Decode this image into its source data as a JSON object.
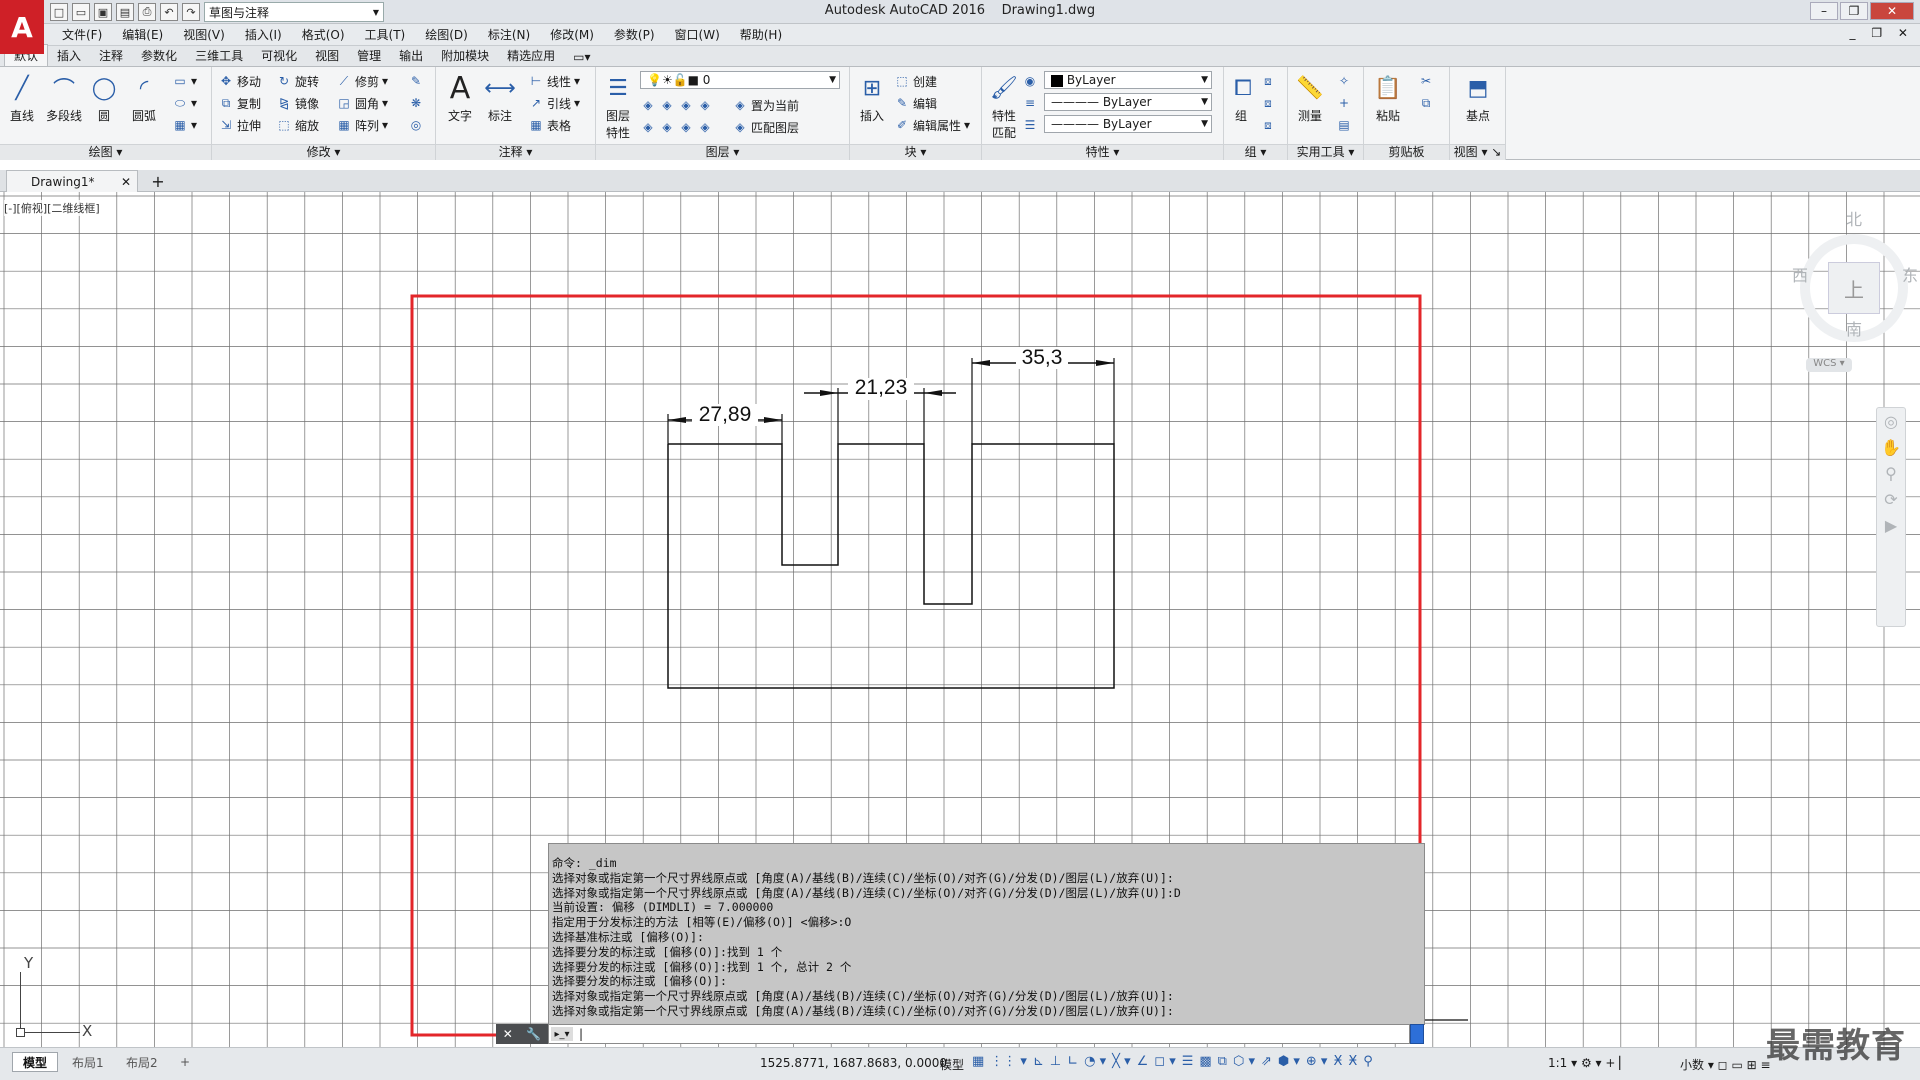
{
  "app": {
    "title": "Autodesk AutoCAD 2016",
    "document": "Drawing1.dwg",
    "logo": "A",
    "workspace": "草图与注释"
  },
  "menus": [
    "文件(F)",
    "编辑(E)",
    "视图(V)",
    "插入(I)",
    "格式(O)",
    "工具(T)",
    "绘图(D)",
    "标注(N)",
    "修改(M)",
    "参数(P)",
    "窗口(W)",
    "帮助(H)"
  ],
  "ribbon_tabs": [
    "默认",
    "插入",
    "注释",
    "参数化",
    "三维工具",
    "可视化",
    "视图",
    "管理",
    "输出",
    "附加模块",
    "精选应用"
  ],
  "ribbon": {
    "draw": {
      "title": "绘图",
      "line": "直线",
      "polyline": "多段线",
      "circle": "圆",
      "arc": "圆弧"
    },
    "modify": {
      "title": "修改",
      "move": "移动",
      "rotate": "旋转",
      "trim": "修剪",
      "copy": "复制",
      "mirror": "镜像",
      "fillet": "圆角",
      "stretch": "拉伸",
      "scale": "缩放",
      "array": "阵列"
    },
    "annotation": {
      "title": "注释",
      "text": "文字",
      "dimension": "标注",
      "linear": "线性",
      "leader": "引线",
      "table": "表格"
    },
    "layers": {
      "title": "图层",
      "properties": "图层\n特性",
      "layer_value": "0",
      "set_current": "置为当前",
      "match_layer": "匹配图层"
    },
    "block": {
      "title": "块",
      "insert": "插入",
      "create": "创建",
      "edit": "编辑",
      "edit_attr": "编辑属性"
    },
    "properties": {
      "title": "特性",
      "match": "特性\n匹配",
      "color": "ByLayer",
      "linetype": "ByLayer",
      "lineweight": "ByLayer"
    },
    "groups": {
      "title": "组",
      "group": "组"
    },
    "utilities": {
      "title": "实用工具",
      "measure": "测量"
    },
    "clipboard": {
      "title": "剪贴板",
      "paste": "粘贴"
    },
    "view": {
      "title": "视图",
      "base": "基点"
    }
  },
  "file_tab": {
    "name": "Drawing1*"
  },
  "viewport": {
    "label": "[-][俯视][二维线框]",
    "viewcube": {
      "north": "北",
      "south": "南",
      "east": "东",
      "west": "西",
      "top": "上",
      "wcs": "WCS"
    },
    "ucs": {
      "x": "X",
      "y": "Y"
    }
  },
  "dimensions": [
    "27,89",
    "21,23",
    "35,3"
  ],
  "command": {
    "lines": [
      "命令: _dim",
      "选择对象或指定第一个尺寸界线原点或 [角度(A)/基线(B)/连续(C)/坐标(O)/对齐(G)/分发(D)/图层(L)/放弃(U)]:",
      "选择对象或指定第一个尺寸界线原点或 [角度(A)/基线(B)/连续(C)/坐标(O)/对齐(G)/分发(D)/图层(L)/放弃(U)]:D",
      "当前设置: 偏移 (DIMDLI) = 7.000000",
      "指定用于分发标注的方法 [相等(E)/偏移(O)] <偏移>:O",
      "选择基准标注或 [偏移(O)]:",
      "选择要分发的标注或 [偏移(O)]:找到 1 个",
      "选择要分发的标注或 [偏移(O)]:找到 1 个, 总计 2 个",
      "选择要分发的标注或 [偏移(O)]:",
      "选择对象或指定第一个尺寸界线原点或 [角度(A)/基线(B)/连续(C)/坐标(O)/对齐(G)/分发(D)/图层(L)/放弃(U)]:",
      "选择对象或指定第一个尺寸界线原点或 [角度(A)/基线(B)/连续(C)/坐标(O)/对齐(G)/分发(D)/图层(L)/放弃(U)]:"
    ],
    "input_value": ""
  },
  "status": {
    "layout_tabs": [
      "模型",
      "布局1",
      "布局2"
    ],
    "coordinates": "1525.8771, 1687.8683, 0.0000",
    "space": "模型",
    "scale": "1:1",
    "units": "小数"
  },
  "watermark": "最需教育",
  "colors": {
    "highlight": "#e3262a",
    "accent": "#2a5ea8",
    "logo": "#cf2027"
  }
}
